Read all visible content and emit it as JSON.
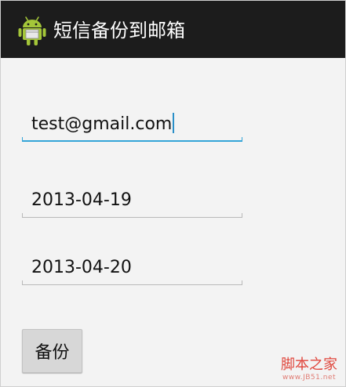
{
  "action_bar": {
    "title": "短信备份到邮箱",
    "icon": "android-robot-icon",
    "background_color": "#1c1c1c"
  },
  "form": {
    "email_value": "test@gmail.com",
    "start_date_value": "2013-04-19",
    "end_date_value": "2013-04-20",
    "backup_button_label": "备份",
    "focus_color": "#34a5d8"
  },
  "watermark": {
    "main_text": "脚本之家",
    "sub_text": "www.JB51.net"
  }
}
